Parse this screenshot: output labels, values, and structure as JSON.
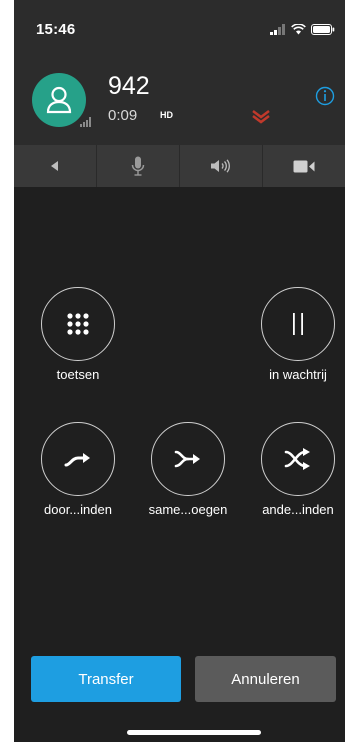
{
  "status_bar": {
    "time": "15:46"
  },
  "call": {
    "number": "942",
    "duration": "0:09",
    "hd_badge": "HD"
  },
  "toolbar": {
    "items": [
      {
        "icon": "back-arrow-icon"
      },
      {
        "icon": "microphone-icon"
      },
      {
        "icon": "speaker-icon"
      },
      {
        "icon": "video-camera-icon"
      }
    ]
  },
  "actions": {
    "keypad": {
      "label": "toetsen",
      "icon": "keypad-icon"
    },
    "hold": {
      "label": "in wachtrij",
      "icon": "pause-icon"
    },
    "forward": {
      "label": "door...inden",
      "icon": "forward-arrow-icon"
    },
    "merge": {
      "label": "same...oegen",
      "icon": "merge-arrow-icon"
    },
    "swap": {
      "label": "ande...inden",
      "icon": "swap-arrows-icon"
    }
  },
  "buttons": {
    "transfer": "Transfer",
    "cancel": "Annuleren"
  },
  "colors": {
    "accent_blue": "#1e9ee1",
    "avatar_green": "#26a189",
    "cancel_gray": "#5b5b5b",
    "badge_red": "#c0392b"
  }
}
